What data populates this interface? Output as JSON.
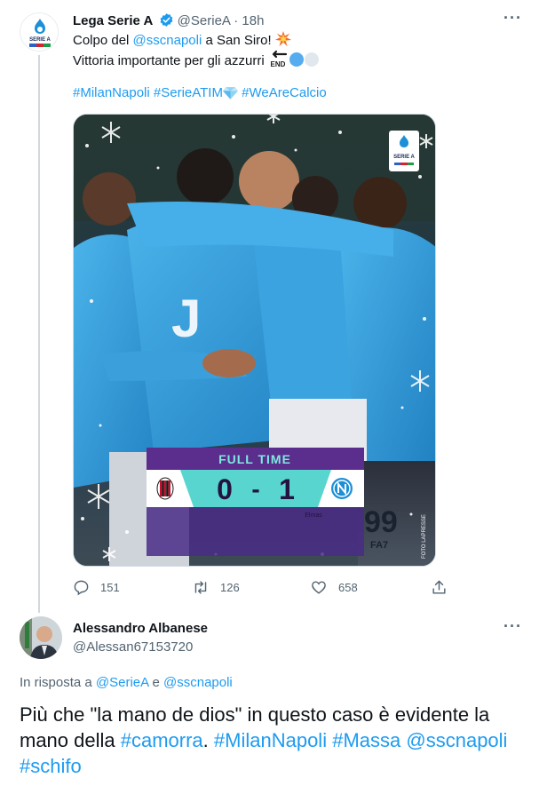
{
  "tweet": {
    "author_name": "Lega Serie A",
    "author_handle": "@SerieA",
    "time": "· 18h",
    "more": "···",
    "text_1a": "Colpo del ",
    "mention": "@sscnapoli",
    "text_1b": " a San Siro! ",
    "text_2": "Vittoria importante per gli azzurri ",
    "end_label": "END",
    "hashtag_1": "#MilanNapoli",
    "hashtag_2": "#SerieATIM",
    "hashtag_3": "#WeAreCalcio",
    "logo_text": "SERIE A",
    "image": {
      "logo_text": "SERIE A",
      "scoreboard_title": "FULL TIME",
      "home_score": "0",
      "away_score": "1",
      "score_separator": "-",
      "scorer": "Elmas",
      "credit": "FOTO LAPRESSE",
      "shirt_number": "99",
      "shirt_name": "FA7"
    },
    "stats": {
      "replies": "151",
      "retweets": "126",
      "likes": "658"
    }
  },
  "reply": {
    "author_name": "Alessandro Albanese",
    "author_handle": "@Alessan67153720",
    "more": "···",
    "replying_prefix": "In risposta a ",
    "replying_to_1": "@SerieA",
    "replying_and": " e ",
    "replying_to_2": "@sscnapoli",
    "text_a": "Più che \"la mano de dios\" in questo caso è evidente la mano della ",
    "hashtag_camorra": "#camorra",
    "text_b": ". ",
    "hashtag_milannapoli": "#MilanNapoli",
    "text_c": " ",
    "hashtag_massa": "#Massa",
    "text_d": " ",
    "mention_napoli": "@sscnapoli",
    "text_e": " ",
    "hashtag_schifo": "#schifo"
  },
  "colors": {
    "link": "#1d9bf0",
    "text": "#0f1419",
    "secondary": "#536471",
    "napoli_blue": "#39a9e6",
    "scoreboard_purple": "#4a2c86"
  }
}
